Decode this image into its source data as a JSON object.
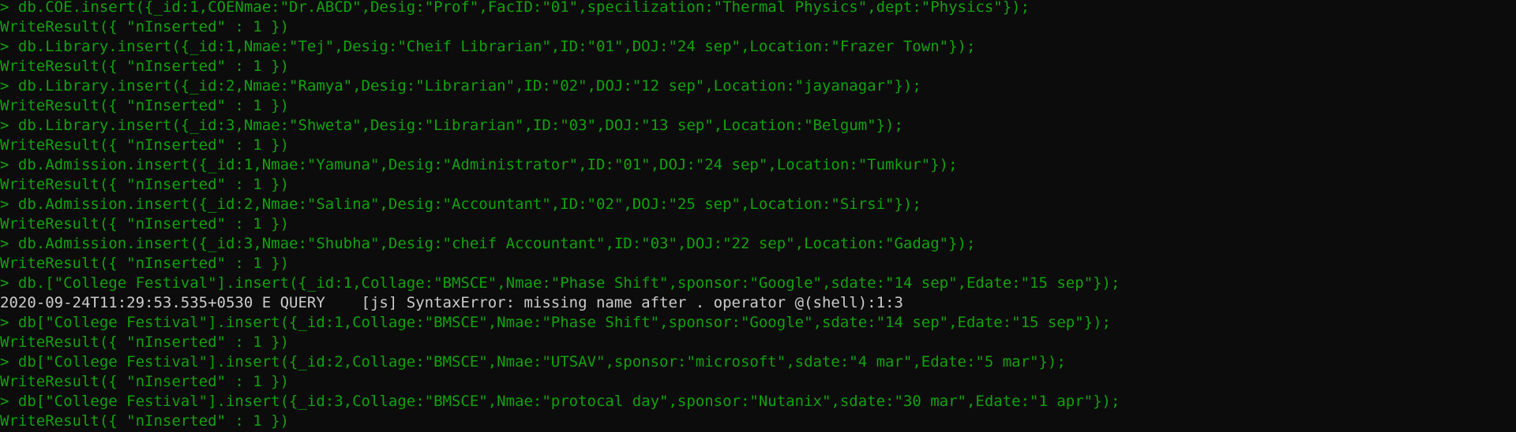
{
  "terminal": {
    "colors": {
      "background": "#0c0c0c",
      "command_text": "#13a10e",
      "output_text": "#13a10e",
      "error_text": "#cccccc"
    },
    "lines": [
      {
        "kind": "command",
        "text": "> db.COE.insert({_id:1,COENmae:\"Dr.ABCD\",Desig:\"Prof\",FacID:\"01\",specilization:\"Thermal Physics\",dept:\"Physics\"});"
      },
      {
        "kind": "output",
        "text": "WriteResult({ \"nInserted\" : 1 })"
      },
      {
        "kind": "command",
        "text": "> db.Library.insert({_id:1,Nmae:\"Tej\",Desig:\"Cheif Librarian\",ID:\"01\",DOJ:\"24 sep\",Location:\"Frazer Town\"});"
      },
      {
        "kind": "output",
        "text": "WriteResult({ \"nInserted\" : 1 })"
      },
      {
        "kind": "command",
        "text": "> db.Library.insert({_id:2,Nmae:\"Ramya\",Desig:\"Librarian\",ID:\"02\",DOJ:\"12 sep\",Location:\"jayanagar\"});"
      },
      {
        "kind": "output",
        "text": "WriteResult({ \"nInserted\" : 1 })"
      },
      {
        "kind": "command",
        "text": "> db.Library.insert({_id:3,Nmae:\"Shweta\",Desig:\"Librarian\",ID:\"03\",DOJ:\"13 sep\",Location:\"Belgum\"});"
      },
      {
        "kind": "output",
        "text": "WriteResult({ \"nInserted\" : 1 })"
      },
      {
        "kind": "command",
        "text": "> db.Admission.insert({_id:1,Nmae:\"Yamuna\",Desig:\"Administrator\",ID:\"01\",DOJ:\"24 sep\",Location:\"Tumkur\"});"
      },
      {
        "kind": "output",
        "text": "WriteResult({ \"nInserted\" : 1 })"
      },
      {
        "kind": "command",
        "text": "> db.Admission.insert({_id:2,Nmae:\"Salina\",Desig:\"Accountant\",ID:\"02\",DOJ:\"25 sep\",Location:\"Sirsi\"});"
      },
      {
        "kind": "output",
        "text": "WriteResult({ \"nInserted\" : 1 })"
      },
      {
        "kind": "command",
        "text": "> db.Admission.insert({_id:3,Nmae:\"Shubha\",Desig:\"cheif Accountant\",ID:\"03\",DOJ:\"22 sep\",Location:\"Gadag\"});"
      },
      {
        "kind": "output",
        "text": "WriteResult({ \"nInserted\" : 1 })"
      },
      {
        "kind": "command",
        "text": "> db.[\"College Festival\"].insert({_id:1,Collage:\"BMSCE\",Nmae:\"Phase Shift\",sponsor:\"Google\",sdate:\"14 sep\",Edate:\"15 sep\"});"
      },
      {
        "kind": "error",
        "text": "2020-09-24T11:29:53.535+0530 E QUERY    [js] SyntaxError: missing name after . operator @(shell):1:3"
      },
      {
        "kind": "command",
        "text": "> db[\"College Festival\"].insert({_id:1,Collage:\"BMSCE\",Nmae:\"Phase Shift\",sponsor:\"Google\",sdate:\"14 sep\",Edate:\"15 sep\"});"
      },
      {
        "kind": "output",
        "text": "WriteResult({ \"nInserted\" : 1 })"
      },
      {
        "kind": "command",
        "text": "> db[\"College Festival\"].insert({_id:2,Collage:\"BMSCE\",Nmae:\"UTSAV\",sponsor:\"microsoft\",sdate:\"4 mar\",Edate:\"5 mar\"});"
      },
      {
        "kind": "output",
        "text": "WriteResult({ \"nInserted\" : 1 })"
      },
      {
        "kind": "command",
        "text": "> db[\"College Festival\"].insert({_id:3,Collage:\"BMSCE\",Nmae:\"protocal day\",sponsor:\"Nutanix\",sdate:\"30 mar\",Edate:\"1 apr\"});"
      },
      {
        "kind": "output",
        "text": "WriteResult({ \"nInserted\" : 1 })"
      }
    ]
  }
}
